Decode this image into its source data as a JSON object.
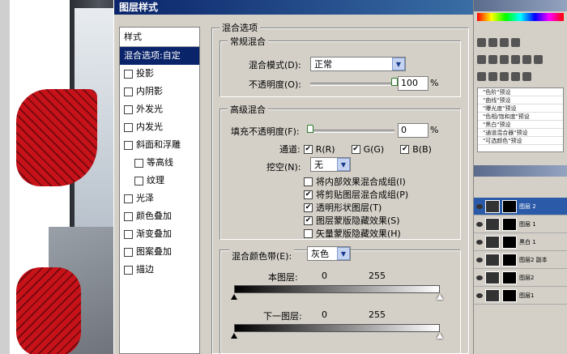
{
  "dialog": {
    "title": "图层样式"
  },
  "styles": {
    "header": "样式",
    "items": [
      {
        "label": "混合选项:自定",
        "checkbox": false,
        "active": true,
        "sub": false
      },
      {
        "label": "投影",
        "checkbox": true,
        "active": false,
        "sub": false
      },
      {
        "label": "内阴影",
        "checkbox": true,
        "active": false,
        "sub": false
      },
      {
        "label": "外发光",
        "checkbox": true,
        "active": false,
        "sub": false
      },
      {
        "label": "内发光",
        "checkbox": true,
        "active": false,
        "sub": false
      },
      {
        "label": "斜面和浮雕",
        "checkbox": true,
        "active": false,
        "sub": false
      },
      {
        "label": "等高线",
        "checkbox": true,
        "active": false,
        "sub": true
      },
      {
        "label": "纹理",
        "checkbox": true,
        "active": false,
        "sub": true
      },
      {
        "label": "光泽",
        "checkbox": true,
        "active": false,
        "sub": false
      },
      {
        "label": "颜色叠加",
        "checkbox": true,
        "active": false,
        "sub": false
      },
      {
        "label": "渐变叠加",
        "checkbox": true,
        "active": false,
        "sub": false
      },
      {
        "label": "图案叠加",
        "checkbox": true,
        "active": false,
        "sub": false
      },
      {
        "label": "描边",
        "checkbox": true,
        "active": false,
        "sub": false
      }
    ]
  },
  "blending": {
    "section_title": "混合选项",
    "general": {
      "title": "常规混合",
      "mode_label": "混合模式(D):",
      "mode_value": "正常",
      "opacity_label": "不透明度(O):",
      "opacity_value": "100",
      "opacity_unit": "%",
      "opacity_fraction": 1.0
    },
    "advanced": {
      "title": "高级混合",
      "fill_label": "填充不透明度(F):",
      "fill_value": "0",
      "fill_unit": "%",
      "fill_fraction": 0.0,
      "channels_label": "通道:",
      "channel_r": "R(R)",
      "channel_g": "G(G)",
      "channel_b": "B(B)",
      "knockout_label": "挖空(N):",
      "knockout_value": "无",
      "options": [
        {
          "label": "将内部效果混合成组(I)",
          "checked": false
        },
        {
          "label": "将剪贴图层混合成组(P)",
          "checked": true
        },
        {
          "label": "透明形状图层(T)",
          "checked": true
        },
        {
          "label": "图层蒙版隐藏效果(S)",
          "checked": true
        },
        {
          "label": "矢量蒙版隐藏效果(H)",
          "checked": false
        }
      ]
    },
    "blend_if": {
      "label": "混合颜色带(E):",
      "value": "灰色",
      "this_layer_label": "本图层:",
      "this_layer_min": "0",
      "this_layer_max": "255",
      "underlying_label": "下一图层:",
      "underlying_min": "0",
      "underlying_max": "255"
    }
  },
  "panels": {
    "presets": [
      "\"色阶\"预设",
      "\"曲线\"预设",
      "\"曝光度\"预设",
      "\"色相/饱和度\"预设",
      "\"黑白\"预设",
      "\"通道混合器\"预设",
      "\"可选颜色\"预设"
    ],
    "layers": [
      {
        "name": "图层 2",
        "selected": true
      },
      {
        "name": "图层 1",
        "selected": false
      },
      {
        "name": "黑白 1",
        "selected": false
      },
      {
        "name": "图层2 副本",
        "selected": false
      },
      {
        "name": "图层2",
        "selected": false
      },
      {
        "name": "图层1",
        "selected": false
      }
    ]
  }
}
